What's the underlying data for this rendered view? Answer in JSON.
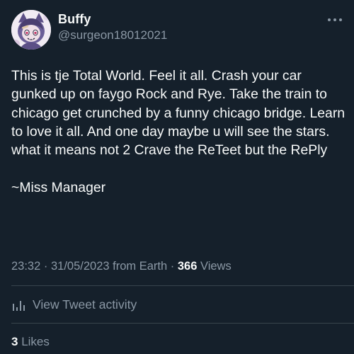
{
  "author": {
    "display_name": "Buffy",
    "handle": "@surgeon18012021",
    "avatar_icon": "avatar-illustration"
  },
  "tweet": {
    "paragraphs": [
      "This is tje Total World. Feel it all. Crash your car gunked up on faygo Rock and Rye. Take the train to chicago get crunched by a funny chicago bridge. Learn to love it all. And one day maybe u will see the stars. what it means not 2 Crave the ReTeet but the RePly",
      "~Miss Manager"
    ]
  },
  "meta": {
    "time": "23:32",
    "separator": " · ",
    "date": "31/05/2023",
    "source": "from Earth",
    "views_count": "366",
    "views_label": "Views"
  },
  "activity": {
    "label": "View Tweet activity",
    "icon": "analytics-bars-icon"
  },
  "likes": {
    "count": "3",
    "label": "Likes"
  },
  "colors": {
    "background": "#15202b",
    "primary_text": "#f7f9f9",
    "secondary_text": "#8b98a5",
    "divider": "#38444d"
  }
}
